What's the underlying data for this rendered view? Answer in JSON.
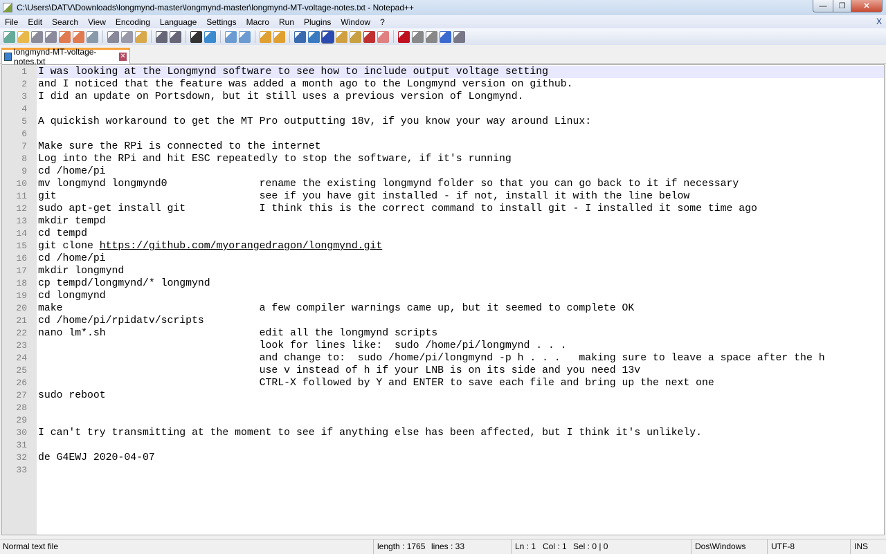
{
  "window": {
    "title": "C:\\Users\\DATV\\Downloads\\longmynd-master\\longmynd-master\\longmynd-MT-voltage-notes.txt - Notepad++",
    "minimize": "—",
    "restore": "❐",
    "close": "✕"
  },
  "menu": {
    "items": [
      "File",
      "Edit",
      "Search",
      "View",
      "Encoding",
      "Language",
      "Settings",
      "Macro",
      "Run",
      "Plugins",
      "Window",
      "?"
    ],
    "close": "X"
  },
  "toolbar": {
    "icons": [
      "new-file",
      "open-file",
      "save",
      "save-all",
      "close",
      "close-all",
      "print",
      "|",
      "cut",
      "copy",
      "paste",
      "|",
      "undo",
      "redo",
      "|",
      "find",
      "replace",
      "|",
      "zoom-in",
      "zoom-out",
      "|",
      "sync-vertical",
      "sync-horizontal",
      "|",
      "word-wrap",
      "show-all-characters",
      "indent-guide",
      "user-defined-language",
      "document-map",
      "function-list",
      "folder-workspace",
      "|",
      "record-macro",
      "stop-recording",
      "playback-macro",
      "run-macro-multiple",
      "save-macro"
    ]
  },
  "tab": {
    "label": "longmynd-MT-voltage-notes.txt",
    "close": "✕"
  },
  "editor": {
    "lines": [
      {
        "code": "I was looking at the Longmynd software to see how to include output voltage setting"
      },
      {
        "code": "and I noticed that the feature was added a month ago to the Longmynd version on github."
      },
      {
        "code": "I did an update on Portsdown, but it still uses a previous version of Longmynd."
      },
      {
        "code": ""
      },
      {
        "code": "A quickish workaround to get the MT Pro outputting 18v, if you know your way around Linux:"
      },
      {
        "code": ""
      },
      {
        "code": "Make sure the RPi is connected to the internet"
      },
      {
        "code": "Log into the RPi and hit ESC repeatedly to stop the software, if it's running"
      },
      {
        "code": "cd /home/pi"
      },
      {
        "code": "mv longmynd longmynd0",
        "comment": "rename the existing longmynd folder so that you can go back to it if necessary"
      },
      {
        "code": "git",
        "comment": "see if you have git installed - if not, install it with the line below"
      },
      {
        "code": "sudo apt-get install git",
        "comment": "I think this is the correct command to install git - I installed it some time ago"
      },
      {
        "code": "mkdir tempd"
      },
      {
        "code": "cd tempd"
      },
      {
        "code": "git clone ",
        "link": "https://github.com/myorangedragon/longmynd.git"
      },
      {
        "code": "cd /home/pi"
      },
      {
        "code": "mkdir longmynd"
      },
      {
        "code": "cp tempd/longmynd/* longmynd"
      },
      {
        "code": "cd longmynd"
      },
      {
        "code": "make",
        "comment": "a few compiler warnings came up, but it seemed to complete OK"
      },
      {
        "code": "cd /home/pi/rpidatv/scripts"
      },
      {
        "code": "nano lm*.sh",
        "comment": "edit all the longmynd scripts"
      },
      {
        "code": "",
        "comment": "look for lines like:  sudo /home/pi/longmynd . . .",
        "guides": true
      },
      {
        "code": "",
        "comment": "and change to:  sudo /home/pi/longmynd -p h . . .   making sure to leave a space after the h",
        "guides": true
      },
      {
        "code": "",
        "comment": "use v instead of h if your LNB is on its side and you need 13v",
        "guides": true
      },
      {
        "code": "",
        "comment": "CTRL-X followed by Y and ENTER to save each file and bring up the next one",
        "guides": true
      },
      {
        "code": "sudo reboot"
      },
      {
        "code": ""
      },
      {
        "code": ""
      },
      {
        "code": "I can't try transmitting at the moment to see if anything else has been affected, but I think it's unlikely."
      },
      {
        "code": ""
      },
      {
        "code": "de G4EWJ 2020-04-07"
      },
      {
        "code": ""
      }
    ],
    "current_line": 1
  },
  "status": {
    "file_type": "Normal text file",
    "length": "length : 1765",
    "lines": "lines : 33",
    "ln": "Ln : 1",
    "col": "Col : 1",
    "sel": "Sel : 0 | 0",
    "eol": "Dos\\Windows",
    "encoding": "UTF-8",
    "mode": "INS"
  }
}
